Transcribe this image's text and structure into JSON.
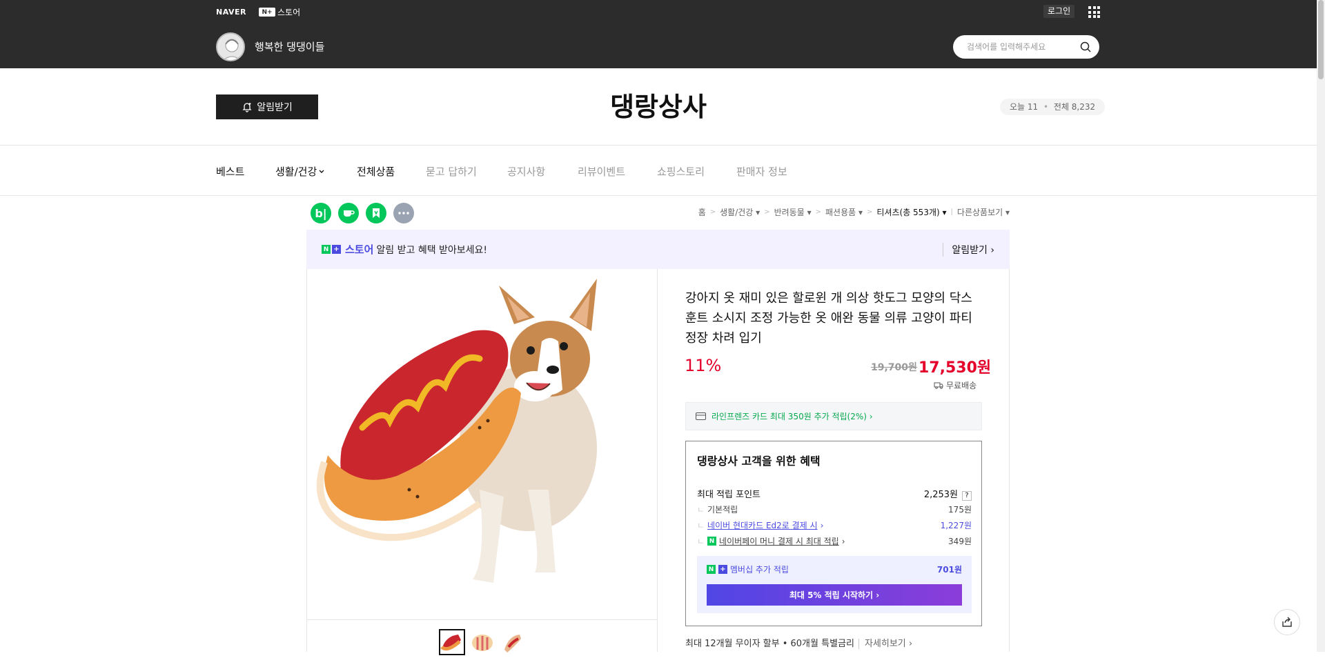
{
  "topbar": {
    "naver_logo": "NAVER",
    "plus_logo_box": "N+",
    "plus_logo_text": "스토어",
    "login_label": "로그인",
    "store_subtitle": "행복한 댕댕이들",
    "search_placeholder": "검색어를 입력해주세요"
  },
  "header": {
    "alarm_label": "알림받기",
    "store_title": "댕랑상사",
    "visit_today": "오늘 11",
    "visit_total": "전체 8,232"
  },
  "nav": {
    "items": [
      "베스트",
      "생활/건강",
      "전체상품",
      "묻고 답하기",
      "공지사항",
      "리뷰이벤트",
      "쇼핑스토리",
      "판매자 정보"
    ]
  },
  "breadcrumb": {
    "items": [
      "홈",
      "생활/건강",
      "반려동물",
      "패션용품",
      "티셔츠(총 553개)",
      "다른상품보기"
    ]
  },
  "promo": {
    "store_label": "스토어",
    "message": "알림 받고 혜택 받아보세요!",
    "action": "알림받기 ›"
  },
  "product": {
    "title": "강아지 옷 재미 있은 할로윈 개 의상 핫도그 모양의 닥스 훈트 소시지 조정 가능한 옷 애완 동물 의류 고양이 파티 정장 차려 입기",
    "discount": "11%",
    "original_price": "19,700원",
    "price": "17,530원",
    "shipping": "무료배송",
    "card_offer": "라인프렌즈 카드 최대 350원 추가 적립(2%) ›"
  },
  "benefit": {
    "title": "댕랑상사 고객을 위한 혜택",
    "max_points_label": "최대 적립 포인트",
    "max_points_value": "2,253원",
    "help": "?",
    "basic_label": "기본적립",
    "basic_value": "175원",
    "card_label": "네이버 현대카드 Ed2로 결제 시",
    "card_value": "1,227원",
    "pay_label": "네이버페이 머니 결제 시 최대 적립",
    "pay_value": "349원",
    "membership_label": "멤버십 추가 적립",
    "membership_value": "701원",
    "membership_button": "최대 5% 적립 시작하기 ›"
  },
  "installment": {
    "text": "최대 12개월 무이자 할부 • 60개월 특별금리",
    "more": "자세히보기 ›"
  }
}
